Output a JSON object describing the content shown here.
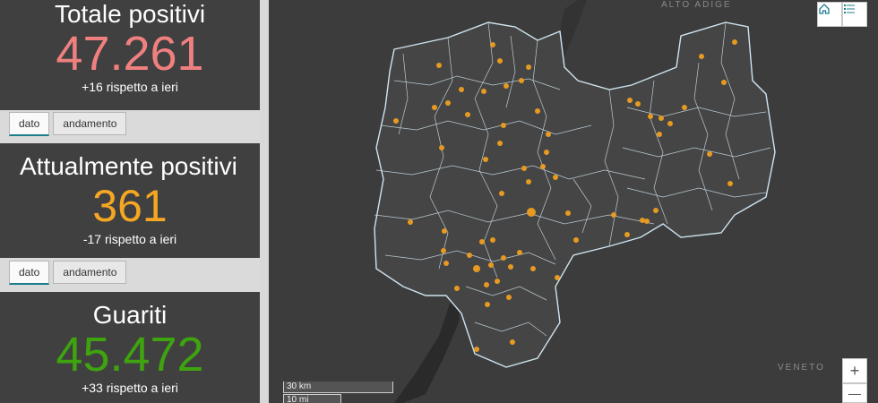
{
  "cards": [
    {
      "title": "Totale positivi",
      "value": "47.261",
      "delta": "+16 rispetto a ieri",
      "color": "#f08080"
    },
    {
      "title": "Attualmente positivi",
      "value": "361",
      "delta": "-17 rispetto a ieri",
      "color": "#f5a623"
    },
    {
      "title": "Guariti",
      "value": "45.472",
      "delta": "+33 rispetto a ieri",
      "color": "#3ea30f"
    }
  ],
  "tabs": {
    "dato": "dato",
    "andamento": "andamento"
  },
  "map": {
    "labels": {
      "alto_adige": "ALTO ADIGE",
      "veneto": "VENETO"
    },
    "zoom_in": "+",
    "zoom_out": "—",
    "scale_km": "30 km",
    "scale_mi": "10 mi",
    "icons": {
      "home": "home-icon",
      "legend": "list-icon"
    },
    "colors": {
      "marker": "#e69a21",
      "boundary": "#cfe4f0"
    }
  }
}
